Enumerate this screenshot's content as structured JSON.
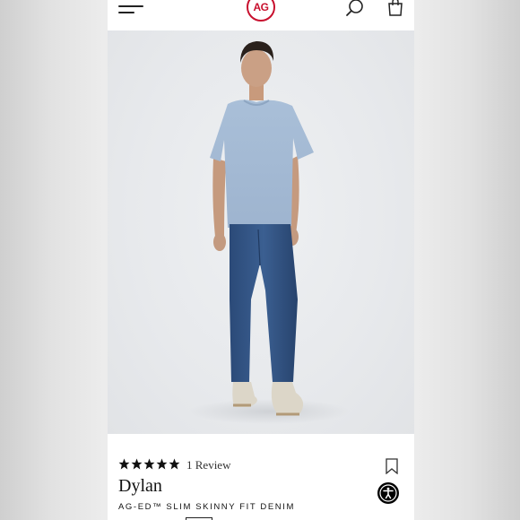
{
  "header": {
    "menu_icon": "hamburger-menu-icon",
    "logo_text": "AG",
    "search_icon": "search-icon",
    "bag_icon": "shopping-bag-icon",
    "brand_color": "#c8102e"
  },
  "hero": {
    "image_icon": "model-photo"
  },
  "product": {
    "rating": 5,
    "rating_max": 5,
    "review_count_label": "1 Review",
    "name": "Dylan",
    "subtitle": "AG-ED™ SLIM SKINNY FIT DENIM",
    "bookmark_icon": "bookmark-icon",
    "accessibility_icon": "accessibility-icon"
  }
}
